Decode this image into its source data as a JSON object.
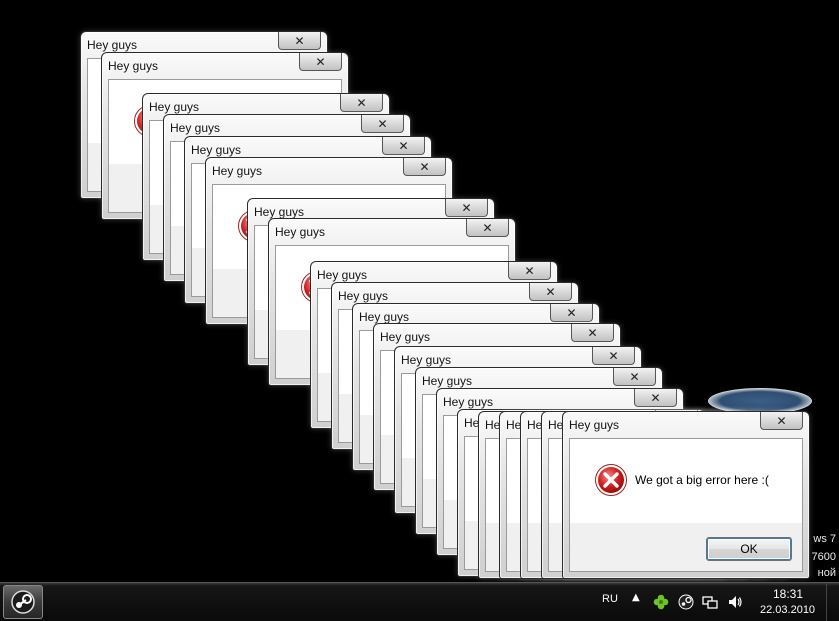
{
  "dialog": {
    "title": "Hey guys",
    "message": "We got a big error here :(",
    "ok_label": "OK",
    "close_glyph": "✕",
    "icon": "error-icon",
    "window_count": 20
  },
  "desktop": {
    "watermark_lines": [
      "ws 7",
      "7600",
      "ной"
    ]
  },
  "taskbar": {
    "pinned_app": "steam-icon",
    "language": "RU",
    "tray_overflow": "▲",
    "tray_icons": [
      "clover-icon",
      "steam-tray-icon",
      "network-icon",
      "volume-icon"
    ],
    "time": "18:31",
    "date": "22.03.2010"
  }
}
